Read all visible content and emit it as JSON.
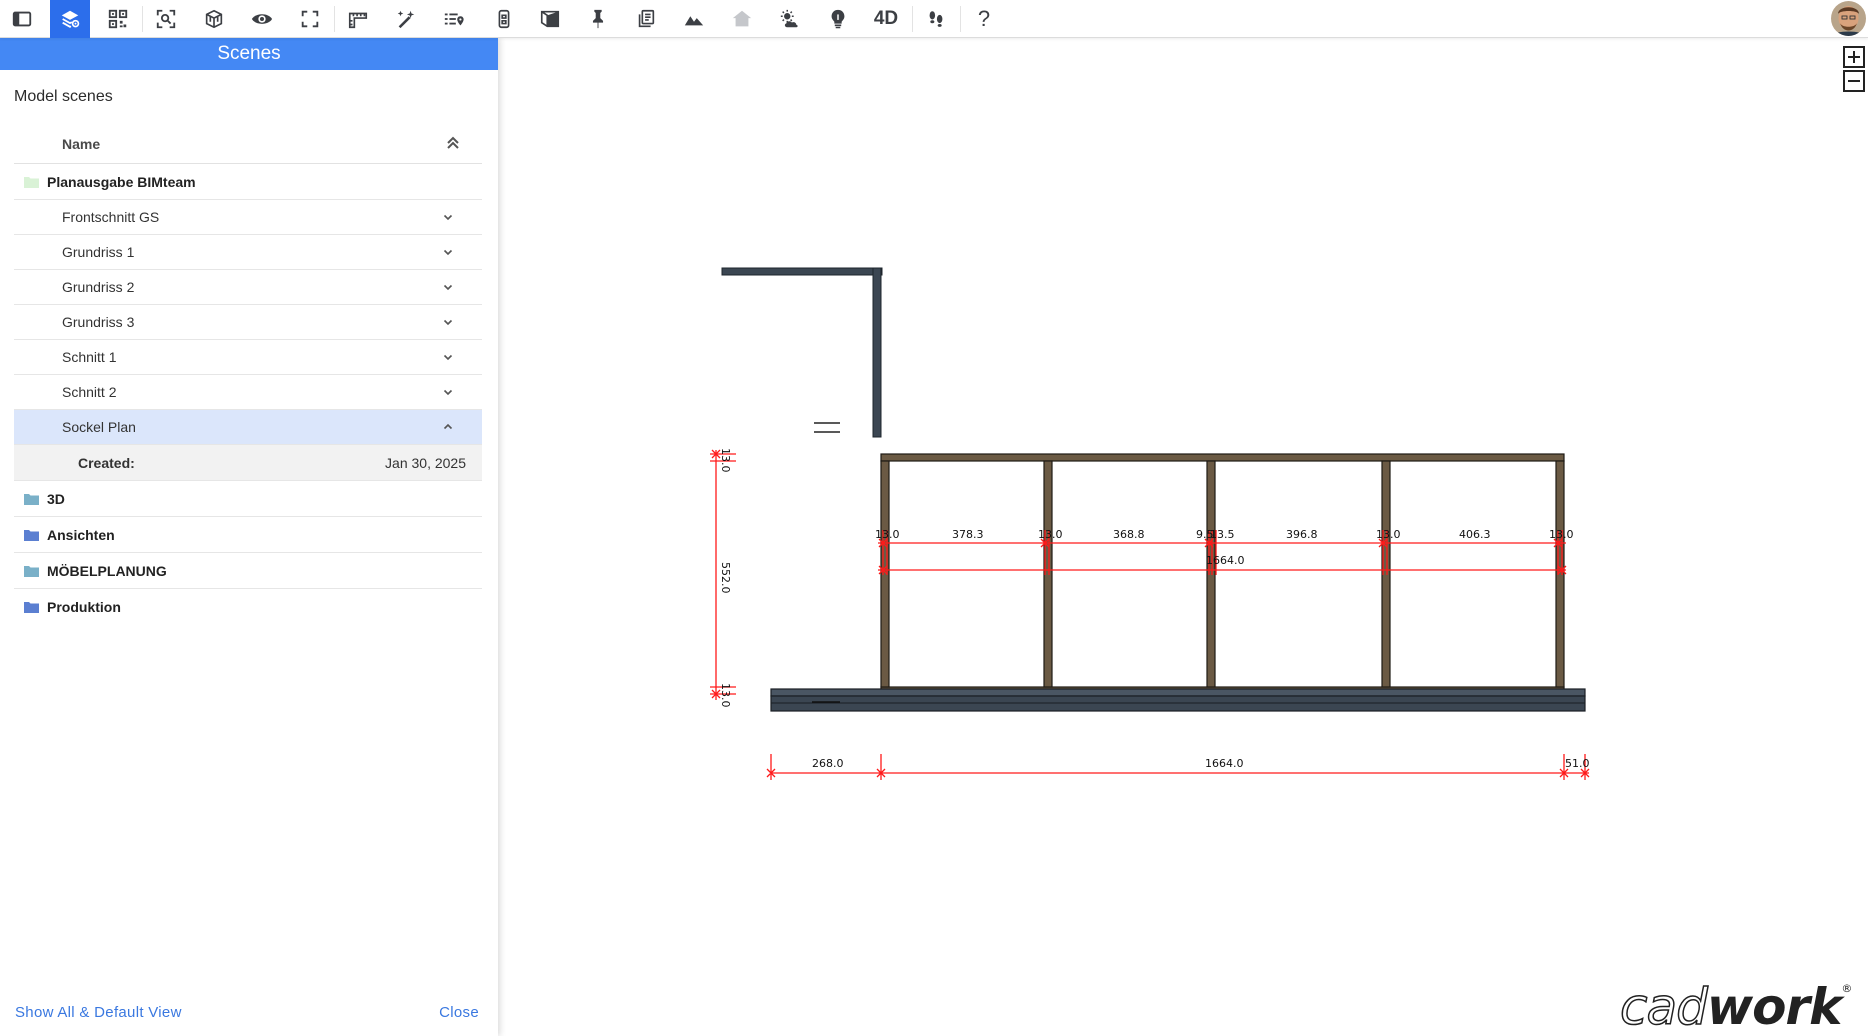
{
  "toolbar": {
    "buttons": [
      {
        "name": "sidebar-toggle-icon"
      },
      {
        "name": "scenes-icon"
      },
      {
        "name": "qr-code-icon"
      },
      {
        "name": "zoom-extents-icon"
      },
      {
        "name": "3d-cube-icon"
      },
      {
        "name": "visibility-eye-icon"
      },
      {
        "name": "fullscreen-icon"
      },
      {
        "name": "measure-ruler-icon"
      },
      {
        "name": "tools-wand-icon"
      },
      {
        "name": "map-list-icon"
      },
      {
        "name": "section-box-icon"
      },
      {
        "name": "wall-view-icon"
      },
      {
        "name": "pin-icon"
      },
      {
        "name": "copy-pages-icon"
      },
      {
        "name": "terrain-icon"
      },
      {
        "name": "house-icon"
      },
      {
        "name": "weather-sun-icon"
      },
      {
        "name": "lightbulb-icon"
      },
      {
        "name": "4d-text-icon",
        "text": "4D"
      },
      {
        "name": "walk-footsteps-icon"
      },
      {
        "name": "help-question-icon",
        "text": "?"
      }
    ],
    "active_color": "#2c6eeb"
  },
  "sidebar": {
    "title": "Scenes",
    "subtitle": "Model scenes",
    "column_name": "Name",
    "group": {
      "label": "Planausgabe BIMteam",
      "items": [
        {
          "label": "Frontschnitt GS"
        },
        {
          "label": "Grundriss 1"
        },
        {
          "label": "Grundriss 2"
        },
        {
          "label": "Grundriss 3"
        },
        {
          "label": "Schnitt 1"
        },
        {
          "label": "Schnitt 2"
        },
        {
          "label": "Sockel Plan"
        }
      ],
      "detail": {
        "key": "Created:",
        "value": "Jan 30, 2025"
      }
    },
    "folders": [
      {
        "label": "3D",
        "color": "#7ab0c8"
      },
      {
        "label": "Ansichten",
        "color": "#5b7fd1"
      },
      {
        "label": "MÖBELPLANUNG",
        "color": "#7ab0c8"
      },
      {
        "label": "Produktion",
        "color": "#5b7fd1"
      }
    ],
    "footer_left": "Show All & Default View",
    "footer_right": "Close",
    "header_color": "#4488f4"
  },
  "drawing": {
    "top_dims": [
      "13.0",
      "378.3",
      "13.0",
      "368.8",
      "9.5",
      "13.5",
      "396.8",
      "13.0",
      "406.3",
      "13.0"
    ],
    "overall_top": "1664.0",
    "left_dims": [
      "13.0",
      "552.0",
      "13.0"
    ],
    "bottom_dims": [
      "268.0",
      "1664.0",
      "51.0"
    ]
  },
  "logo": {
    "light": "cad",
    "bold": "work",
    "mark": "®"
  }
}
